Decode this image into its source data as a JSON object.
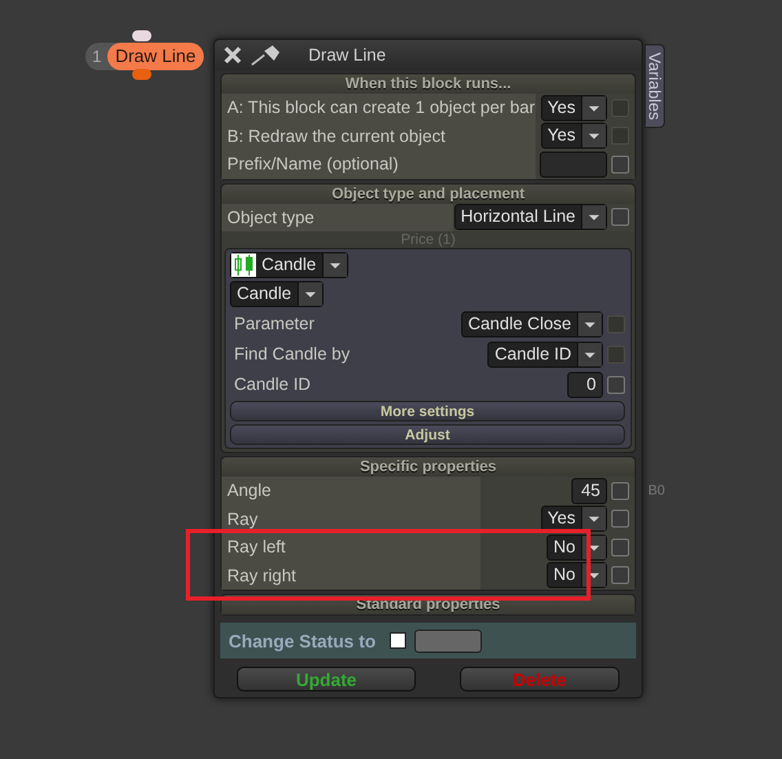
{
  "node": {
    "number": "1",
    "title": "Draw Line"
  },
  "panel": {
    "title": "Draw Line",
    "side_tab": "Variables"
  },
  "sections": [
    {
      "title": "When this block runs...",
      "rows": [
        {
          "kind": "select",
          "label": "A: This block can create 1 object per bar",
          "value": "Yes",
          "checkbox_disabled": true,
          "highlighted": false
        },
        {
          "kind": "select",
          "label": "B: Redraw the current object",
          "value": "Yes",
          "checkbox_disabled": true,
          "highlighted": false
        },
        {
          "kind": "text",
          "label": "Prefix/Name (optional)",
          "value": "",
          "checkbox_disabled": false,
          "highlighted": false
        }
      ]
    },
    {
      "title": "Object type and placement",
      "rows": [
        {
          "kind": "select",
          "label": "Object type",
          "value": "Horizontal Line",
          "checkbox_disabled": false,
          "highlighted": false
        }
      ],
      "group": {
        "title": "Price (1)",
        "sources": [
          {
            "value": "Candle",
            "icon": true
          },
          {
            "value": "Candle",
            "icon": false
          }
        ],
        "rows": [
          {
            "kind": "select",
            "label": "Parameter",
            "value": "Candle Close",
            "checkbox_disabled": true
          },
          {
            "kind": "select",
            "label": "Find Candle by",
            "value": "Candle ID",
            "checkbox_disabled": true
          },
          {
            "kind": "number",
            "label": "Candle ID",
            "value": "0",
            "checkbox_disabled": false
          }
        ],
        "buttons": [
          "More settings",
          "Adjust"
        ]
      }
    },
    {
      "title": "Specific properties",
      "rows": [
        {
          "kind": "number",
          "label": "Angle",
          "value": "45",
          "checkbox_disabled": false,
          "suffix": "B0",
          "highlighted": false
        },
        {
          "kind": "select",
          "label": "Ray",
          "value": "Yes",
          "checkbox_disabled": false,
          "highlighted": false
        },
        {
          "kind": "select",
          "label": "Ray left",
          "value": "No",
          "checkbox_disabled": false,
          "highlighted": true
        },
        {
          "kind": "select",
          "label": "Ray right",
          "value": "No",
          "checkbox_disabled": false,
          "highlighted": true
        }
      ]
    },
    {
      "title": "Standard properties",
      "status": {
        "label": "Change Status to",
        "checked": false
      }
    }
  ],
  "footer": [
    {
      "kind": "update",
      "label": "Update"
    },
    {
      "kind": "delete",
      "label": "Delete"
    }
  ]
}
